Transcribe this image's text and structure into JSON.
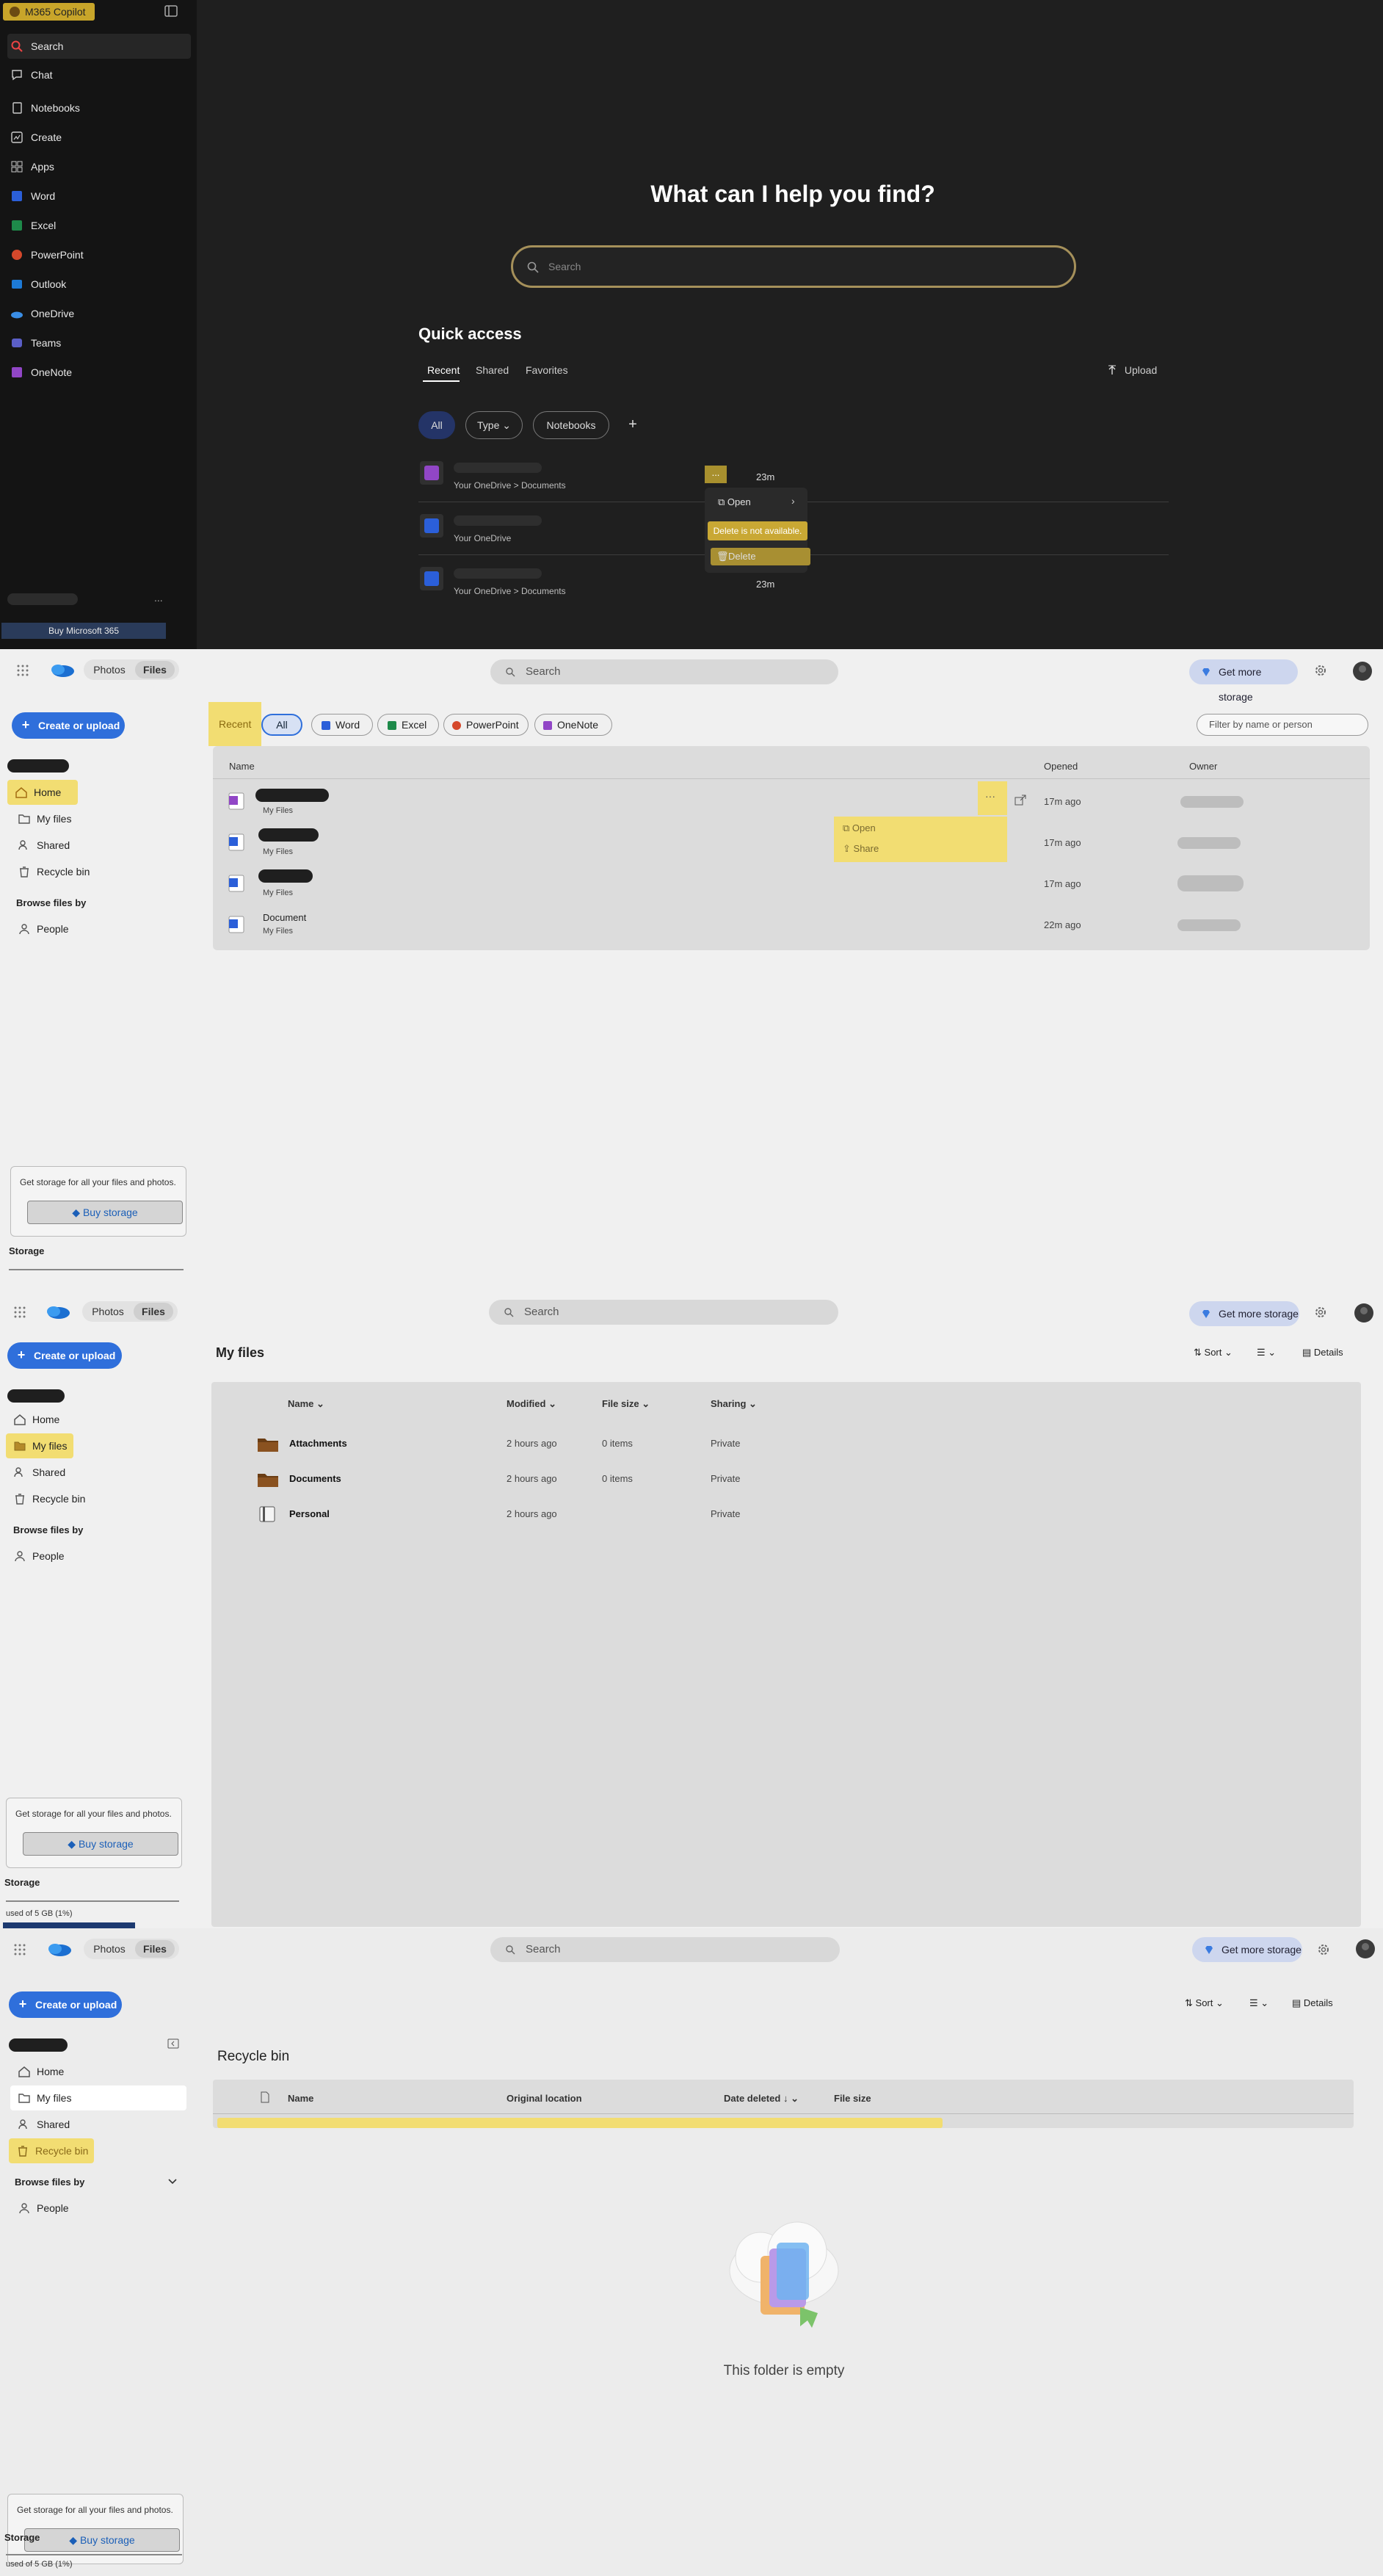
{
  "copilot": {
    "brand": "M365 Copilot",
    "nav": [
      "Search",
      "Chat",
      "Notebooks",
      "Create",
      "Apps",
      "Word",
      "Excel",
      "PowerPoint",
      "Outlook",
      "OneDrive",
      "Teams",
      "OneNote"
    ],
    "buy": "Buy Microsoft 365",
    "title": "What can I help you find?",
    "search_placeholder": "Search",
    "quick_access": "Quick access",
    "tabs": [
      "Recent",
      "Shared",
      "Favorites"
    ],
    "upload": "Upload",
    "chips": [
      "All",
      "Type",
      "Notebooks",
      "+"
    ],
    "rows": [
      {
        "location": "Your OneDrive > Documents",
        "time": "23m"
      },
      {
        "location": "Your OneDrive",
        "time": ""
      },
      {
        "location": "Your OneDrive > Documents",
        "time": "23m"
      }
    ],
    "context_menu": {
      "open": "Open",
      "delete_tooltip": "Delete is not available.",
      "delete": "Delete"
    },
    "more": "..."
  },
  "onedrive_home": {
    "toggle": [
      "Photos",
      "Files"
    ],
    "search": "Search",
    "get_more": "Get more storage",
    "create": "Create or upload",
    "nav": [
      "Home",
      "My files",
      "Shared",
      "Recycle bin"
    ],
    "browse": "Browse files by",
    "people": "People",
    "filters": [
      "Recent",
      "All",
      "Word",
      "Excel",
      "PowerPoint",
      "OneNote"
    ],
    "filter_placeholder": "Filter by name or person",
    "columns": [
      "Name",
      "Opened",
      "Owner"
    ],
    "rows": [
      {
        "sub": "My Files",
        "opened": "17m ago"
      },
      {
        "sub": "My Files",
        "opened": "17m ago"
      },
      {
        "sub": "My Files",
        "opened": "17m ago"
      },
      {
        "name": "Document",
        "sub": "My Files",
        "opened": "22m ago"
      }
    ],
    "menu": {
      "open": "Open",
      "share": "Share"
    },
    "storage_text": "Get storage for all your files and photos.",
    "buy_storage": "Buy storage",
    "storage": "Storage"
  },
  "onedrive_myfiles": {
    "title": "My files",
    "sort": "Sort",
    "details": "Details",
    "columns": [
      "Name",
      "Modified",
      "File size",
      "Sharing"
    ],
    "rows": [
      {
        "name": "Attachments",
        "modified": "2 hours ago",
        "size": "0 items",
        "sharing": "Private"
      },
      {
        "name": "Documents",
        "modified": "2 hours ago",
        "size": "0 items",
        "sharing": "Private"
      },
      {
        "name": "Personal",
        "modified": "2 hours ago",
        "size": "",
        "sharing": "Private"
      }
    ],
    "used": "used of 5 GB (1%)"
  },
  "onedrive_recycle": {
    "title": "Recycle bin",
    "columns": [
      "Name",
      "Original location",
      "Date deleted",
      "File size"
    ],
    "empty": "This folder is empty",
    "used": "used of 5 GB (1%)"
  },
  "colors": {
    "accent": "#2f6fdb",
    "highlight": "#f2dd72",
    "dark_bg": "#1f1f1f"
  }
}
